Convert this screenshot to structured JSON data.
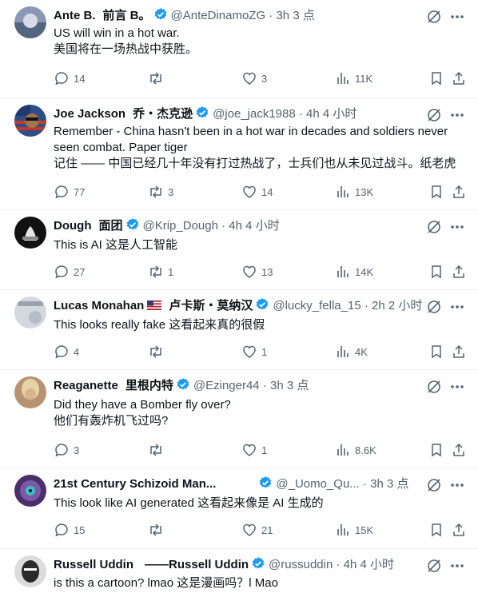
{
  "tweets": [
    {
      "name": "Ante B.",
      "name_cn": "前言 B。",
      "handle": "@AnteDinamoZG",
      "meta": " · 3h",
      "meta_cn": "3 点",
      "lines": [
        "US will win in a hot war.",
        "美国将在一场热战中获胜。"
      ],
      "replies": "14",
      "reposts": "",
      "likes": "3",
      "views": "11K",
      "avatar_color": "#6b7b9a"
    },
    {
      "name": "Joe Jackson",
      "name_cn": "乔・杰克逊",
      "handle": "@joe_jack1988",
      "meta": " · 4h",
      "meta_cn": "4 小时",
      "lines": [
        "Remember - China hasn't been in a hot war in decades and soldiers never",
        "seen combat. Paper tiger",
        "记住 —— 中国已经几十年没有打过热战了，士兵们也从未见过战斗。纸老虎"
      ],
      "replies": "77",
      "reposts": "3",
      "likes": "14",
      "views": "13K",
      "avatar_color": "#3c5a8a"
    },
    {
      "name": "Dough",
      "name_cn": "面团",
      "handle": "@Krip_Dough",
      "meta": " · 4h",
      "meta_cn": "4 小时",
      "lines": [
        "This is AI  这是人工智能"
      ],
      "replies": "27",
      "reposts": "1",
      "likes": "13",
      "views": "14K",
      "avatar_color": "#111111"
    },
    {
      "name": "Lucas Monahan",
      "name_cn": "卢卡斯・莫纳汉",
      "handle": "@lucky_fella_15",
      "meta": " · 2h",
      "meta_cn": "2 小时",
      "lines": [
        "This looks really fake  这看起来真的很假"
      ],
      "replies": "4",
      "reposts": "",
      "likes": "1",
      "views": "4K",
      "avatar_color": "#c9ced6"
    },
    {
      "name": "Reaganette",
      "name_cn": "里根内特",
      "handle": "@Ezinger44",
      "meta": " · 3h",
      "meta_cn": "3 点",
      "lines": [
        "Did they have a Bomber fly over?",
        "他们有轰炸机飞过吗?"
      ],
      "replies": "3",
      "reposts": "",
      "likes": "1",
      "views": "8.6K",
      "avatar_color": "#c8a98a"
    },
    {
      "name": "21st Century Schizoid Man...",
      "name_cn": "",
      "handle": "@_Uomo_Qu...",
      "meta": " · 3h",
      "meta_cn": "3 点",
      "lines": [
        "This look like AI generated  这看起来像是 AI 生成的"
      ],
      "replies": "15",
      "reposts": "",
      "likes": "21",
      "views": "15K",
      "avatar_color": "#5a3b7a"
    },
    {
      "name": "Russell Uddin",
      "name_cn": "——Russell Uddin",
      "handle": "@russuddin",
      "meta": " · 4h",
      "meta_cn": "4 小时",
      "lines": [
        "is this a cartoon? lmao  这是漫画吗？l Mao"
      ],
      "replies": "",
      "reposts": "",
      "likes": "",
      "views": "",
      "avatar_color": "#2b2b2b"
    }
  ],
  "colors": {
    "verified": "#1d9bf0",
    "muted": "#536471",
    "text": "#0f1419"
  }
}
